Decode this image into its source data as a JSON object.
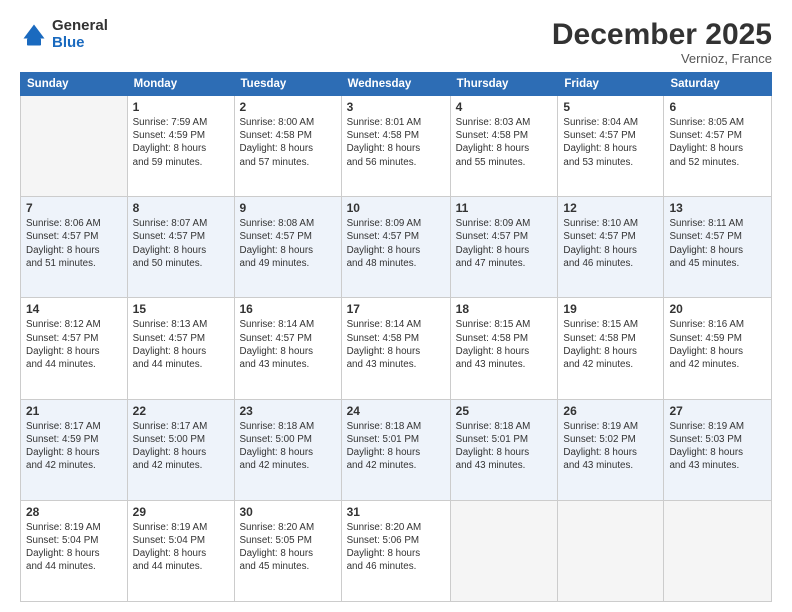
{
  "logo": {
    "general": "General",
    "blue": "Blue"
  },
  "header": {
    "month": "December 2025",
    "location": "Vernioz, France"
  },
  "weekdays": [
    "Sunday",
    "Monday",
    "Tuesday",
    "Wednesday",
    "Thursday",
    "Friday",
    "Saturday"
  ],
  "weeks": [
    [
      {
        "day": "",
        "sunrise": "",
        "sunset": "",
        "daylight": "",
        "daylight2": "",
        "empty": true
      },
      {
        "day": "1",
        "sunrise": "Sunrise: 7:59 AM",
        "sunset": "Sunset: 4:59 PM",
        "daylight": "Daylight: 8 hours",
        "daylight2": "and 59 minutes."
      },
      {
        "day": "2",
        "sunrise": "Sunrise: 8:00 AM",
        "sunset": "Sunset: 4:58 PM",
        "daylight": "Daylight: 8 hours",
        "daylight2": "and 57 minutes."
      },
      {
        "day": "3",
        "sunrise": "Sunrise: 8:01 AM",
        "sunset": "Sunset: 4:58 PM",
        "daylight": "Daylight: 8 hours",
        "daylight2": "and 56 minutes."
      },
      {
        "day": "4",
        "sunrise": "Sunrise: 8:03 AM",
        "sunset": "Sunset: 4:58 PM",
        "daylight": "Daylight: 8 hours",
        "daylight2": "and 55 minutes."
      },
      {
        "day": "5",
        "sunrise": "Sunrise: 8:04 AM",
        "sunset": "Sunset: 4:57 PM",
        "daylight": "Daylight: 8 hours",
        "daylight2": "and 53 minutes."
      },
      {
        "day": "6",
        "sunrise": "Sunrise: 8:05 AM",
        "sunset": "Sunset: 4:57 PM",
        "daylight": "Daylight: 8 hours",
        "daylight2": "and 52 minutes."
      }
    ],
    [
      {
        "day": "7",
        "sunrise": "Sunrise: 8:06 AM",
        "sunset": "Sunset: 4:57 PM",
        "daylight": "Daylight: 8 hours",
        "daylight2": "and 51 minutes."
      },
      {
        "day": "8",
        "sunrise": "Sunrise: 8:07 AM",
        "sunset": "Sunset: 4:57 PM",
        "daylight": "Daylight: 8 hours",
        "daylight2": "and 50 minutes."
      },
      {
        "day": "9",
        "sunrise": "Sunrise: 8:08 AM",
        "sunset": "Sunset: 4:57 PM",
        "daylight": "Daylight: 8 hours",
        "daylight2": "and 49 minutes."
      },
      {
        "day": "10",
        "sunrise": "Sunrise: 8:09 AM",
        "sunset": "Sunset: 4:57 PM",
        "daylight": "Daylight: 8 hours",
        "daylight2": "and 48 minutes."
      },
      {
        "day": "11",
        "sunrise": "Sunrise: 8:09 AM",
        "sunset": "Sunset: 4:57 PM",
        "daylight": "Daylight: 8 hours",
        "daylight2": "and 47 minutes."
      },
      {
        "day": "12",
        "sunrise": "Sunrise: 8:10 AM",
        "sunset": "Sunset: 4:57 PM",
        "daylight": "Daylight: 8 hours",
        "daylight2": "and 46 minutes."
      },
      {
        "day": "13",
        "sunrise": "Sunrise: 8:11 AM",
        "sunset": "Sunset: 4:57 PM",
        "daylight": "Daylight: 8 hours",
        "daylight2": "and 45 minutes."
      }
    ],
    [
      {
        "day": "14",
        "sunrise": "Sunrise: 8:12 AM",
        "sunset": "Sunset: 4:57 PM",
        "daylight": "Daylight: 8 hours",
        "daylight2": "and 44 minutes."
      },
      {
        "day": "15",
        "sunrise": "Sunrise: 8:13 AM",
        "sunset": "Sunset: 4:57 PM",
        "daylight": "Daylight: 8 hours",
        "daylight2": "and 44 minutes."
      },
      {
        "day": "16",
        "sunrise": "Sunrise: 8:14 AM",
        "sunset": "Sunset: 4:57 PM",
        "daylight": "Daylight: 8 hours",
        "daylight2": "and 43 minutes."
      },
      {
        "day": "17",
        "sunrise": "Sunrise: 8:14 AM",
        "sunset": "Sunset: 4:58 PM",
        "daylight": "Daylight: 8 hours",
        "daylight2": "and 43 minutes."
      },
      {
        "day": "18",
        "sunrise": "Sunrise: 8:15 AM",
        "sunset": "Sunset: 4:58 PM",
        "daylight": "Daylight: 8 hours",
        "daylight2": "and 43 minutes."
      },
      {
        "day": "19",
        "sunrise": "Sunrise: 8:15 AM",
        "sunset": "Sunset: 4:58 PM",
        "daylight": "Daylight: 8 hours",
        "daylight2": "and 42 minutes."
      },
      {
        "day": "20",
        "sunrise": "Sunrise: 8:16 AM",
        "sunset": "Sunset: 4:59 PM",
        "daylight": "Daylight: 8 hours",
        "daylight2": "and 42 minutes."
      }
    ],
    [
      {
        "day": "21",
        "sunrise": "Sunrise: 8:17 AM",
        "sunset": "Sunset: 4:59 PM",
        "daylight": "Daylight: 8 hours",
        "daylight2": "and 42 minutes."
      },
      {
        "day": "22",
        "sunrise": "Sunrise: 8:17 AM",
        "sunset": "Sunset: 5:00 PM",
        "daylight": "Daylight: 8 hours",
        "daylight2": "and 42 minutes."
      },
      {
        "day": "23",
        "sunrise": "Sunrise: 8:18 AM",
        "sunset": "Sunset: 5:00 PM",
        "daylight": "Daylight: 8 hours",
        "daylight2": "and 42 minutes."
      },
      {
        "day": "24",
        "sunrise": "Sunrise: 8:18 AM",
        "sunset": "Sunset: 5:01 PM",
        "daylight": "Daylight: 8 hours",
        "daylight2": "and 42 minutes."
      },
      {
        "day": "25",
        "sunrise": "Sunrise: 8:18 AM",
        "sunset": "Sunset: 5:01 PM",
        "daylight": "Daylight: 8 hours",
        "daylight2": "and 43 minutes."
      },
      {
        "day": "26",
        "sunrise": "Sunrise: 8:19 AM",
        "sunset": "Sunset: 5:02 PM",
        "daylight": "Daylight: 8 hours",
        "daylight2": "and 43 minutes."
      },
      {
        "day": "27",
        "sunrise": "Sunrise: 8:19 AM",
        "sunset": "Sunset: 5:03 PM",
        "daylight": "Daylight: 8 hours",
        "daylight2": "and 43 minutes."
      }
    ],
    [
      {
        "day": "28",
        "sunrise": "Sunrise: 8:19 AM",
        "sunset": "Sunset: 5:04 PM",
        "daylight": "Daylight: 8 hours",
        "daylight2": "and 44 minutes."
      },
      {
        "day": "29",
        "sunrise": "Sunrise: 8:19 AM",
        "sunset": "Sunset: 5:04 PM",
        "daylight": "Daylight: 8 hours",
        "daylight2": "and 44 minutes."
      },
      {
        "day": "30",
        "sunrise": "Sunrise: 8:20 AM",
        "sunset": "Sunset: 5:05 PM",
        "daylight": "Daylight: 8 hours",
        "daylight2": "and 45 minutes."
      },
      {
        "day": "31",
        "sunrise": "Sunrise: 8:20 AM",
        "sunset": "Sunset: 5:06 PM",
        "daylight": "Daylight: 8 hours",
        "daylight2": "and 46 minutes."
      },
      {
        "day": "",
        "sunrise": "",
        "sunset": "",
        "daylight": "",
        "daylight2": "",
        "empty": true
      },
      {
        "day": "",
        "sunrise": "",
        "sunset": "",
        "daylight": "",
        "daylight2": "",
        "empty": true
      },
      {
        "day": "",
        "sunrise": "",
        "sunset": "",
        "daylight": "",
        "daylight2": "",
        "empty": true
      }
    ]
  ]
}
